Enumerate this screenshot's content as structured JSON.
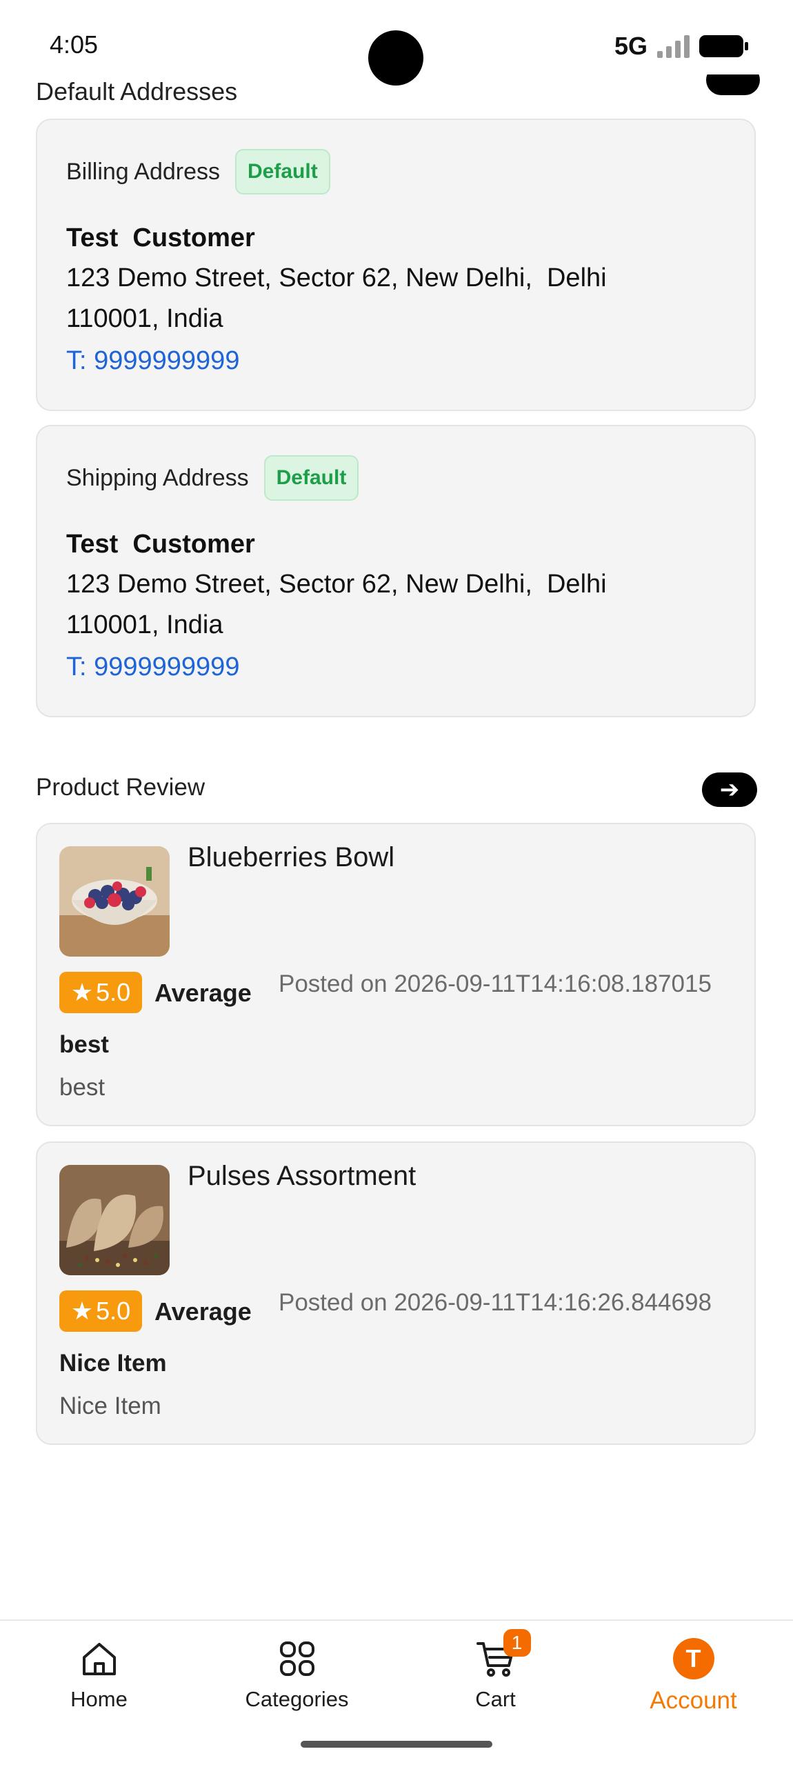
{
  "status_bar": {
    "time": "4:05",
    "network": "5G"
  },
  "scrolled_header": {
    "title": "Default Addresses"
  },
  "addresses": [
    {
      "label": "Billing Address",
      "badge": "Default",
      "name": "Test  Customer",
      "line1": "123 Demo Street, Sector 62, New Delhi,  Delhi",
      "line2": "110001, India",
      "phone": "T: 9999999999"
    },
    {
      "label": "Shipping Address",
      "badge": "Default",
      "name": "Test  Customer",
      "line1": "123 Demo Street, Sector 62, New Delhi,  Delhi",
      "line2": "110001, India",
      "phone": "T: 9999999999"
    }
  ],
  "product_review": {
    "title": "Product Review",
    "reviews": [
      {
        "product": "Blueberries Bowl",
        "rating": "5.0",
        "rating_text": "Average",
        "posted": "Posted on 2026-09-11T14:16:08.187015",
        "review_title": "best",
        "review_body": "best"
      },
      {
        "product": "Pulses Assortment",
        "rating": "5.0",
        "rating_text": "Average",
        "posted": "Posted on 2026-09-11T14:16:26.844698",
        "review_title": "Nice Item",
        "review_body": "Nice Item"
      }
    ]
  },
  "bottom_nav": {
    "items": [
      {
        "label": "Home",
        "icon": "home-icon"
      },
      {
        "label": "Categories",
        "icon": "categories-icon"
      },
      {
        "label": "Cart",
        "icon": "cart-icon",
        "badge": "1"
      },
      {
        "label": "Account",
        "icon": "avatar",
        "avatar_letter": "T",
        "active": true
      }
    ]
  },
  "colors": {
    "accent": "#f46b00",
    "rating": "#f79a0e",
    "link": "#1f64d6",
    "badge_green": "#1e9e49"
  }
}
